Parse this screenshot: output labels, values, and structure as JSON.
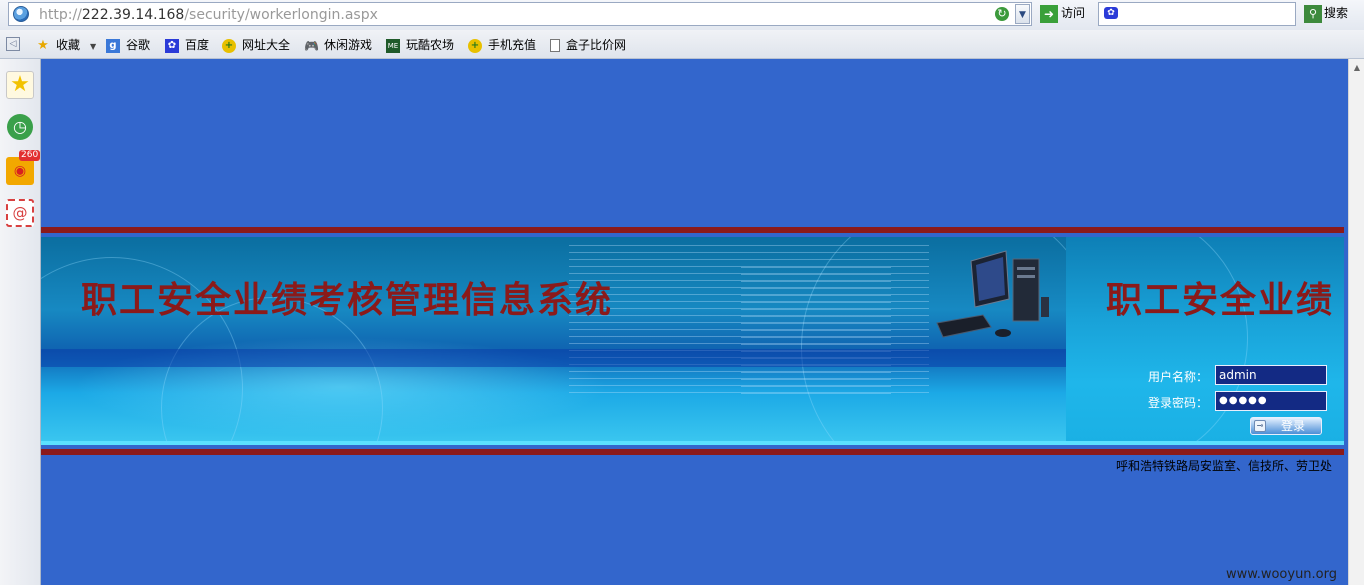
{
  "browser": {
    "url_prefix": "http://",
    "url_host": "222.39.14.168",
    "url_path": "/security/workerlongin.aspx",
    "go_label": "访问",
    "search_label": "搜索"
  },
  "favorites": {
    "items": [
      {
        "label": "收藏"
      },
      {
        "label": "谷歌"
      },
      {
        "label": "百度"
      },
      {
        "label": "网址大全"
      },
      {
        "label": "休闲游戏"
      },
      {
        "label": "玩酷农场"
      },
      {
        "label": "手机充值"
      },
      {
        "label": "盒子比价网"
      }
    ]
  },
  "sidebar": {
    "weibo_badge": "260"
  },
  "banner": {
    "title": "职工安全业绩考核管理信息系统",
    "title_right": "职工安全业绩"
  },
  "login": {
    "username_label": "用户名称：",
    "username_value": "admin",
    "password_label": "登录密码：",
    "password_value": "●●●●●",
    "submit_label": "登录"
  },
  "footer": {
    "org_text": "呼和浩特铁路局安监室、信技所、劳卫处"
  },
  "watermark": "www.wooyun.org",
  "colors": {
    "page_bg": "#3366cc",
    "title_red": "#8b1a1a",
    "input_bg": "#132a84"
  }
}
